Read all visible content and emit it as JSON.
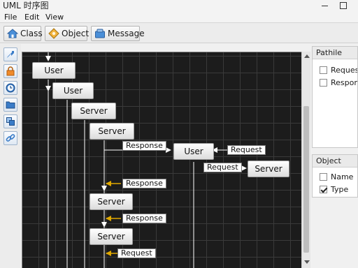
{
  "window": {
    "title": "UML 时序图"
  },
  "menu": {
    "file": "File",
    "edit": "Edit",
    "view": "View"
  },
  "toolbar": {
    "class_label": "Class",
    "object_label": "Object",
    "message_label": "Message"
  },
  "left_tools": [
    "pointer-icon",
    "lock-icon",
    "clock-icon",
    "folder-icon",
    "copy-icon",
    "link-icon"
  ],
  "diagram": {
    "nodes": {
      "user1": "User",
      "user2": "User",
      "server1": "Server",
      "server2": "Server",
      "user3": "User",
      "server3": "Server",
      "server4": "Server",
      "server5": "Server"
    },
    "messages": {
      "response1": "Response",
      "request1": "Request",
      "request2": "Request",
      "response2": "Response",
      "response3": "Response",
      "request3": "Request"
    }
  },
  "pathile_panel": {
    "title": "Pathile",
    "items": [
      {
        "label": "Request",
        "checked": false
      },
      {
        "label": "Response",
        "checked": false
      }
    ]
  },
  "object_panel": {
    "title": "Object",
    "items": [
      {
        "label": "Name",
        "checked": false
      },
      {
        "label": "Type",
        "checked": true
      }
    ]
  },
  "colors": {
    "canvas_bg": "#1c1c1c",
    "grid": "#3a3a3a",
    "wire": "#ffffff",
    "return_arrow": "#e0a800",
    "tool_blue": "#3a7cc8"
  }
}
